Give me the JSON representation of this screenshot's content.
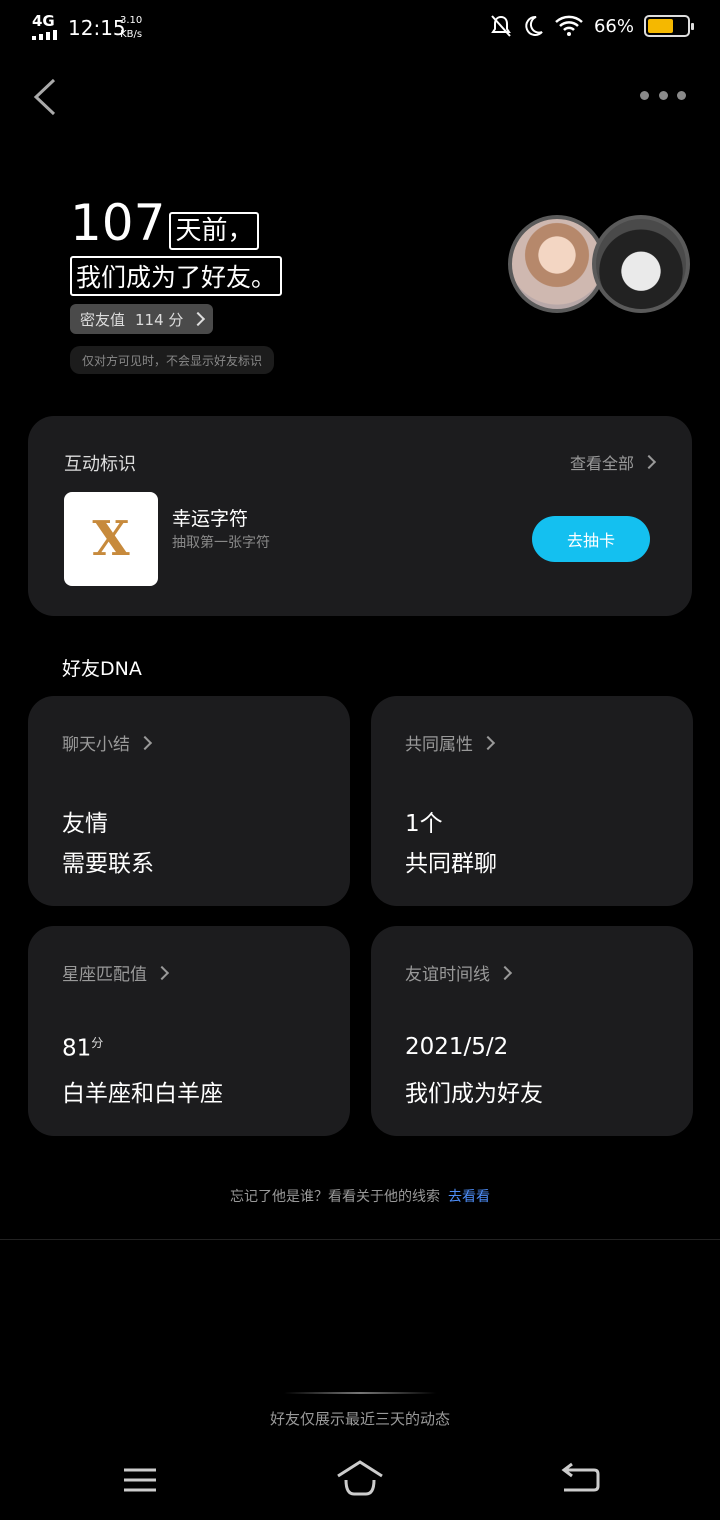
{
  "status": {
    "network": "4G",
    "time": "12:15",
    "speed_value": "3.10",
    "speed_unit": "KB/s",
    "battery": "66%",
    "battery_level": 0.66,
    "battery_color": "#f5b800"
  },
  "header": {
    "back_icon": "chevron-left-icon",
    "more_icon": "more-dots-icon"
  },
  "hero": {
    "days_number": "107",
    "days_suffix": "天前，",
    "became_text": "我们成为了好友。",
    "score_label": "密友值",
    "score_value": "114 分",
    "privacy_note": "仅对方可见时，不会显示好友标识"
  },
  "interaction_card": {
    "title": "互动标识",
    "view_all": "查看全部",
    "item_icon_letter": "X",
    "item_title": "幸运字符",
    "item_subtitle": "抽取第一张字符",
    "action_button": "去抽卡",
    "accent_color": "#14c0f0"
  },
  "dna": {
    "section_label": "好友DNA",
    "tiles": [
      {
        "header": "聊天小结",
        "value": "友情",
        "sub": "需要联系"
      },
      {
        "header": "共同属性",
        "value": "1个",
        "sub": "共同群聊"
      },
      {
        "header": "星座匹配值",
        "value": "81",
        "value_suffix": "分",
        "sub": "白羊座和白羊座"
      },
      {
        "header": "友谊时间线",
        "value": "2021/5/2",
        "sub": "我们成为好友"
      }
    ]
  },
  "footer": {
    "hint": "忘记了他是谁？看看关于他的线索",
    "hint_link": "去看看",
    "link_color": "#4d8cf5",
    "bottom_note": "好友仅展示最近三天的动态"
  },
  "navbar": {
    "menu_icon": "menu-icon",
    "home_icon": "home-icon",
    "back_icon": "back-arrow-icon"
  }
}
